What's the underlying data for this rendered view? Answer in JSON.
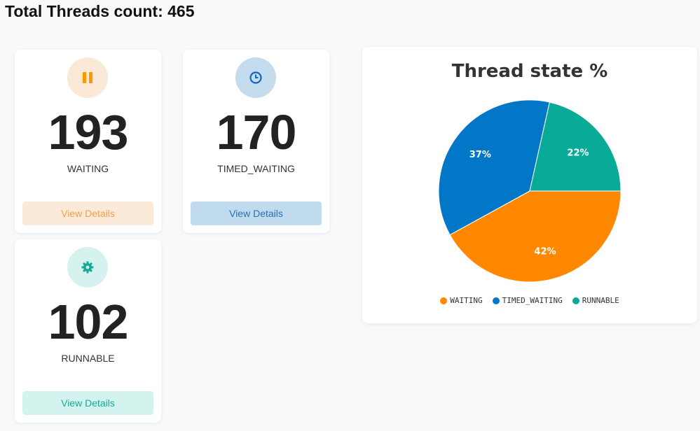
{
  "header": {
    "title": "Total Threads count: 465"
  },
  "cards": [
    {
      "count": "193",
      "label": "WAITING",
      "button": "View Details",
      "icon": "pause-icon",
      "color": "#ff9800",
      "icon_bg": "#fbe9d7",
      "btn_bg": "#fbe9d9",
      "btn_text": "#f5a04a"
    },
    {
      "count": "170",
      "label": "TIMED_WAITING",
      "button": "View Details",
      "icon": "clock-icon",
      "color": "#1565c0",
      "icon_bg": "#c3dcee",
      "btn_bg": "#c1dbee",
      "btn_text": "#2a6fb0"
    },
    {
      "count": "102",
      "label": "RUNNABLE",
      "button": "View Details",
      "icon": "gear-icon",
      "color": "#17a89a",
      "icon_bg": "#d6f2ef",
      "btn_bg": "#d4f3ee",
      "btn_text": "#17a89a"
    }
  ],
  "chart_data": {
    "type": "pie",
    "title": "Thread state %",
    "slices": [
      {
        "label": "WAITING",
        "value": 42,
        "color": "#ff8800",
        "text": "42%"
      },
      {
        "label": "TIMED_WAITING",
        "value": 36.5,
        "color": "#0277c8",
        "text": "37%"
      },
      {
        "label": "RUNNABLE",
        "value": 21.5,
        "color": "#0aaa98",
        "text": "22%"
      }
    ],
    "legend_position": "bottom"
  }
}
